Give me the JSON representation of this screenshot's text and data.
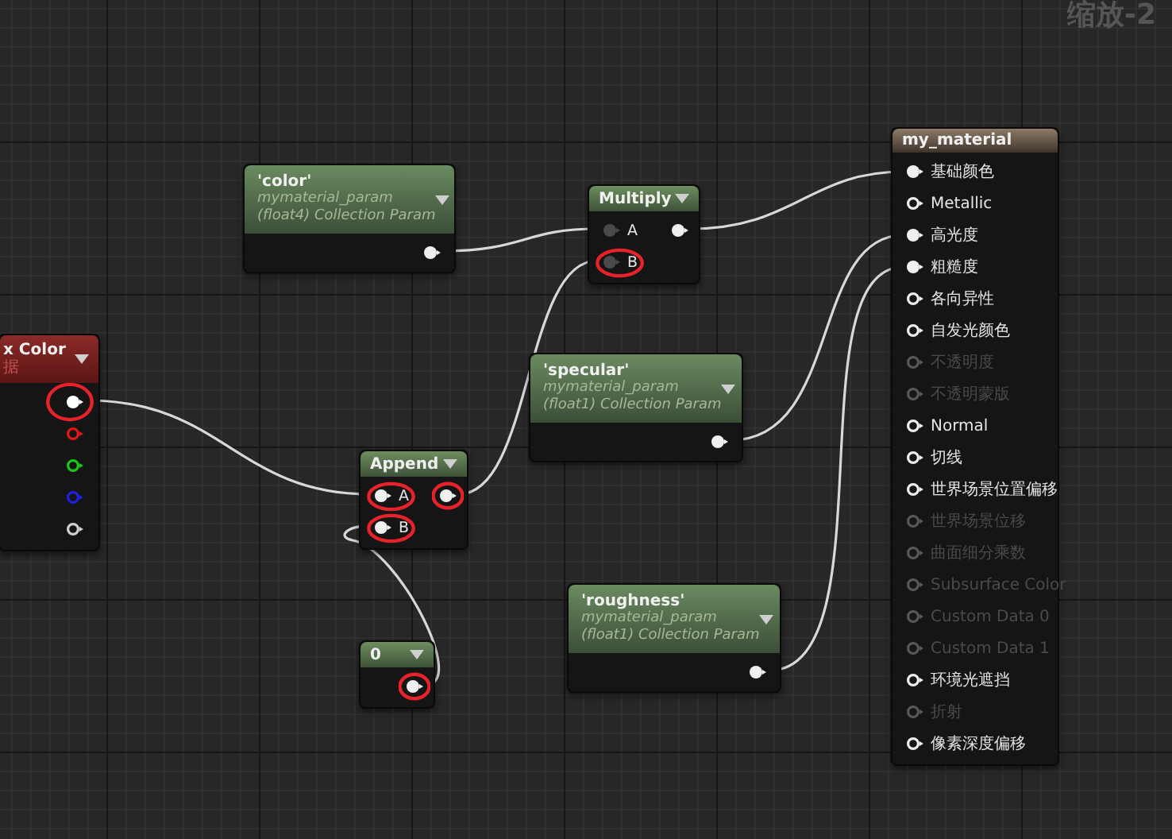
{
  "zoom_label": "缩放-2",
  "nodes": [
    {
      "kind": "material",
      "title": "my_material",
      "rows": [
        {
          "label": "基础颜色",
          "disabled": false,
          "in": {
            "connected": true,
            "highlighted": false
          }
        },
        {
          "label": "Metallic",
          "disabled": false,
          "in": {
            "connected": false,
            "highlighted": false
          }
        },
        {
          "label": "高光度",
          "disabled": false,
          "in": {
            "connected": true,
            "highlighted": false
          }
        },
        {
          "label": "粗糙度",
          "disabled": false,
          "in": {
            "connected": true,
            "highlighted": false
          }
        },
        {
          "label": "各向异性",
          "disabled": false,
          "in": {
            "connected": false,
            "highlighted": false
          }
        },
        {
          "label": "自发光颜色",
          "disabled": false,
          "in": {
            "connected": false,
            "highlighted": false
          }
        },
        {
          "label": "不透明度",
          "disabled": true,
          "in": {
            "connected": false,
            "highlighted": false
          }
        },
        {
          "label": "不透明蒙版",
          "disabled": true,
          "in": {
            "connected": false,
            "highlighted": false
          }
        },
        {
          "label": "Normal",
          "disabled": false,
          "in": {
            "connected": false,
            "highlighted": false
          }
        },
        {
          "label": "切线",
          "disabled": false,
          "in": {
            "connected": false,
            "highlighted": false
          }
        },
        {
          "label": "世界场景位置偏移",
          "disabled": false,
          "in": {
            "connected": false,
            "highlighted": false
          }
        },
        {
          "label": "世界场景位移",
          "disabled": true,
          "in": {
            "connected": false,
            "highlighted": false
          }
        },
        {
          "label": "曲面细分乘数",
          "disabled": true,
          "in": {
            "connected": false,
            "highlighted": false
          }
        },
        {
          "label": "Subsurface Color",
          "disabled": true,
          "in": {
            "connected": false,
            "highlighted": false
          }
        },
        {
          "label": "Custom Data 0",
          "disabled": true,
          "in": {
            "connected": false,
            "highlighted": false
          }
        },
        {
          "label": "Custom Data 1",
          "disabled": true,
          "in": {
            "connected": false,
            "highlighted": false
          }
        },
        {
          "label": "环境光遮挡",
          "disabled": false,
          "in": {
            "connected": false,
            "highlighted": false
          }
        },
        {
          "label": "折射",
          "disabled": true,
          "in": {
            "connected": false,
            "highlighted": false
          }
        },
        {
          "label": "像素深度偏移",
          "disabled": false,
          "in": {
            "connected": false,
            "highlighted": false
          }
        }
      ]
    },
    {
      "kind": "parameter",
      "title": "'color'",
      "subtitle": [
        "mymaterial_param",
        "(float4) Collection Param"
      ],
      "rows": [
        {
          "out": {
            "connected": true,
            "highlighted": false
          }
        }
      ]
    },
    {
      "kind": "operator",
      "title": "Multiply",
      "rows": [
        {
          "label": "A",
          "in": {
            "connected": true,
            "dimmed": true,
            "highlighted": false
          },
          "out": {
            "connected": true,
            "highlighted": false
          }
        },
        {
          "label": "B",
          "in": {
            "connected": true,
            "dimmed": true,
            "highlighted": true
          }
        }
      ]
    },
    {
      "kind": "vertex",
      "title": "x Color",
      "subtitle": [
        "据"
      ],
      "rows": [
        {
          "out": {
            "connected": true,
            "color": "#ffffff",
            "highlighted": true
          }
        },
        {
          "out": {
            "connected": false,
            "color": "#e01818",
            "highlighted": false
          }
        },
        {
          "out": {
            "connected": false,
            "color": "#18c818",
            "highlighted": false
          }
        },
        {
          "out": {
            "connected": false,
            "color": "#2020e0",
            "highlighted": false
          }
        },
        {
          "out": {
            "connected": false,
            "color": "#d0d0d0",
            "highlighted": false
          }
        }
      ]
    },
    {
      "kind": "parameter",
      "title": "'specular'",
      "subtitle": [
        "mymaterial_param",
        "(float1) Collection Param"
      ],
      "rows": [
        {
          "out": {
            "connected": true,
            "highlighted": false
          }
        }
      ]
    },
    {
      "kind": "operator",
      "title": "Append",
      "rows": [
        {
          "label": "A",
          "in": {
            "connected": true,
            "highlighted": true
          },
          "out": {
            "connected": true,
            "highlighted": true
          }
        },
        {
          "label": "B",
          "in": {
            "connected": true,
            "highlighted": true
          }
        }
      ]
    },
    {
      "kind": "parameter",
      "title": "'roughness'",
      "subtitle": [
        "mymaterial_param",
        "(float1) Collection Param"
      ],
      "rows": [
        {
          "out": {
            "connected": true,
            "highlighted": false
          }
        }
      ]
    },
    {
      "kind": "operator",
      "title": "0",
      "rows": [
        {
          "out": {
            "connected": true,
            "highlighted": true
          }
        }
      ]
    }
  ]
}
